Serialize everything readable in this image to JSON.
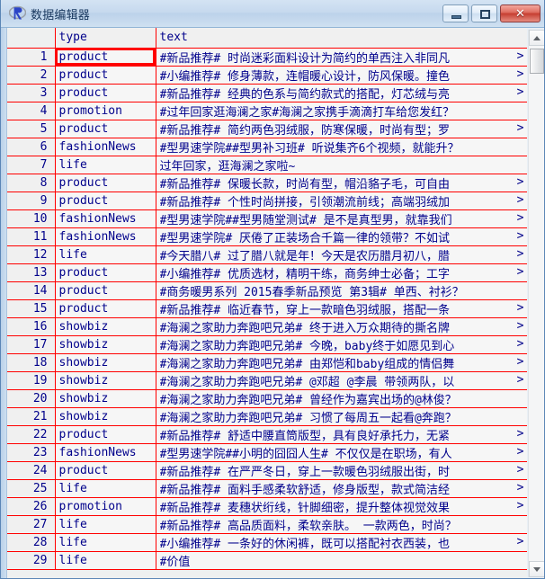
{
  "window": {
    "title": "数据编辑器",
    "logo_letter": "R",
    "buttons": {
      "minimize_label": "—",
      "maximize_label": "□",
      "close_label": "✕"
    }
  },
  "grid": {
    "columns": [
      "type",
      "text"
    ],
    "corner_label": "",
    "selected_cell": {
      "row": 1,
      "column": "type"
    },
    "truncation_marker": ">",
    "rows": [
      {
        "n": "1",
        "type": "product",
        "text": "#新品推荐# 时尚迷彩面料设计为简约的单西注入非同凡",
        "truncated": true
      },
      {
        "n": "2",
        "type": "product",
        "text": "#小编推荐# 修身薄款，连帽暖心设计，防风保暖。撞色",
        "truncated": true
      },
      {
        "n": "3",
        "type": "product",
        "text": "#新品推荐# 经典的色系与简约款式的搭配，灯芯绒与亮",
        "truncated": true
      },
      {
        "n": "4",
        "type": "promotion",
        "text": "#过年回家逛海澜之家#海澜之家携手滴滴打车给您发红？",
        "truncated": false
      },
      {
        "n": "5",
        "type": "product",
        "text": "#新品推荐# 简约两色羽绒服，防寒保暖，时尚有型；罗",
        "truncated": true
      },
      {
        "n": "6",
        "type": "fashionNews",
        "text": "#型男速学院##型男补习班# 听说集齐6个视频，就能升？",
        "truncated": false
      },
      {
        "n": "7",
        "type": "life",
        "text": "过年回家，逛海澜之家啦~",
        "truncated": false
      },
      {
        "n": "8",
        "type": "product",
        "text": "#新品推荐# 保暖长款，时尚有型，帽沿貉子毛，可自由",
        "truncated": true
      },
      {
        "n": "9",
        "type": "product",
        "text": "#新品推荐# 个性时尚拼接，引领潮流前线；高端羽绒加",
        "truncated": true
      },
      {
        "n": "10",
        "type": "fashionNews",
        "text": "#型男速学院##型男随堂测试# 是不是真型男，就靠我们",
        "truncated": true
      },
      {
        "n": "11",
        "type": "fashionNews",
        "text": "#型男速学院# 厌倦了正装场合千篇一律的领带？不如试",
        "truncated": true
      },
      {
        "n": "12",
        "type": "life",
        "text": "#今天腊八# 过了腊八就是年！今天是农历腊月初八，腊",
        "truncated": true
      },
      {
        "n": "13",
        "type": "product",
        "text": "#小编推荐# 优质选材，精明干练，商务绅士必备；工字",
        "truncated": true
      },
      {
        "n": "14",
        "type": "product",
        "text": "#商务暖男系列 2015春季新品预览 第3辑# 单西、衬衫？",
        "truncated": false
      },
      {
        "n": "15",
        "type": "product",
        "text": "#新品推荐# 临近春节，穿上一款暗色羽绒服，搭配一条",
        "truncated": true
      },
      {
        "n": "16",
        "type": "showbiz",
        "text": "#海澜之家助力奔跑吧兄弟# 终于进入万众期待的撕名牌",
        "truncated": true
      },
      {
        "n": "17",
        "type": "showbiz",
        "text": "#海澜之家助力奔跑吧兄弟# 今晚，baby终于如愿见到心",
        "truncated": true
      },
      {
        "n": "18",
        "type": "showbiz",
        "text": "#海澜之家助力奔跑吧兄弟# 由郑恺和baby组成的情侣舞",
        "truncated": true
      },
      {
        "n": "19",
        "type": "showbiz",
        "text": "#海澜之家助力奔跑吧兄弟# @邓超 @李晨 带领两队，以",
        "truncated": true
      },
      {
        "n": "20",
        "type": "showbiz",
        "text": "#海澜之家助力奔跑吧兄弟# 曾经作为嘉宾出场的@林俊？",
        "truncated": false
      },
      {
        "n": "21",
        "type": "showbiz",
        "text": "#海澜之家助力奔跑吧兄弟# 习惯了每周五一起看@奔跑？",
        "truncated": false
      },
      {
        "n": "22",
        "type": "product",
        "text": "#新品推荐# 舒适中腰直筒版型，具有良好承托力，无紧",
        "truncated": true
      },
      {
        "n": "23",
        "type": "fashionNews",
        "text": "#型男速学院##小明的囧囧人生# 不仅仅是在职场，有人",
        "truncated": true
      },
      {
        "n": "24",
        "type": "product",
        "text": "#新品推荐# 在严严冬日，穿上一款暖色羽绒服出街，时",
        "truncated": true
      },
      {
        "n": "25",
        "type": "life",
        "text": "#新品推荐# 面料手感柔软舒适，修身版型，款式简洁经",
        "truncated": true
      },
      {
        "n": "26",
        "type": "promotion",
        "text": "#新品推荐# 麦穗状绗线，针脚细密，提升整体视觉效果",
        "truncated": true
      },
      {
        "n": "27",
        "type": "life",
        "text": "#新品推荐# 高品质面料，柔软亲肤。 一款两色，时尚？",
        "truncated": false
      },
      {
        "n": "28",
        "type": "life",
        "text": "#小编推荐# 一条好的休闲裤，既可以搭配衬衣西装，也",
        "truncated": true
      },
      {
        "n": "29",
        "type": "life",
        "text": "#价值",
        "truncated": false
      }
    ]
  },
  "scrollbar": {
    "up_arrow": "▲",
    "down_arrow": "▼"
  },
  "colors": {
    "grid_line": "#ff0000",
    "text": "#00008b",
    "title_text": "#17365d",
    "close_button": "#c63f32"
  }
}
